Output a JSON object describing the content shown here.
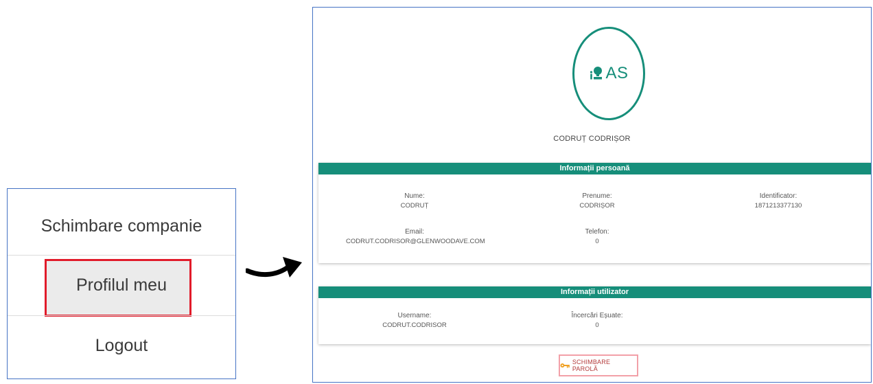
{
  "menu": {
    "items": [
      {
        "label": "Schimbare companie"
      },
      {
        "label": "Profilul meu"
      },
      {
        "label": "Logout"
      }
    ]
  },
  "profile": {
    "avatar_initials": "AS",
    "full_name": "CODRUȚ CODRIȘOR",
    "personal_info": {
      "title": "Informații persoană",
      "nume_label": "Nume:",
      "nume_value": "CODRUȚ",
      "prenume_label": "Prenume:",
      "prenume_value": "CODRIȘOR",
      "identificator_label": "Identificator:",
      "identificator_value": "1871213377130",
      "email_label": "Email:",
      "email_value": "CODRUT.CODRISOR@GLENWOODAVE.COM",
      "telefon_label": "Telefon:",
      "telefon_value": "0"
    },
    "user_info": {
      "title": "Informații utilizator",
      "username_label": "Username:",
      "username_value": "CODRUT.CODRISOR",
      "incercari_label": "Încercări Eșuate:",
      "incercari_value": "0"
    },
    "change_password_label": "SCHIMBARE PAROLĂ"
  },
  "colors": {
    "accent": "#168e7a",
    "highlight_border": "#e11b2a",
    "frame_border": "#4472c4"
  },
  "icons": {
    "avatar_logo": "person-pin-icon",
    "change_password": "key-icon",
    "transition": "curved-arrow-icon"
  }
}
